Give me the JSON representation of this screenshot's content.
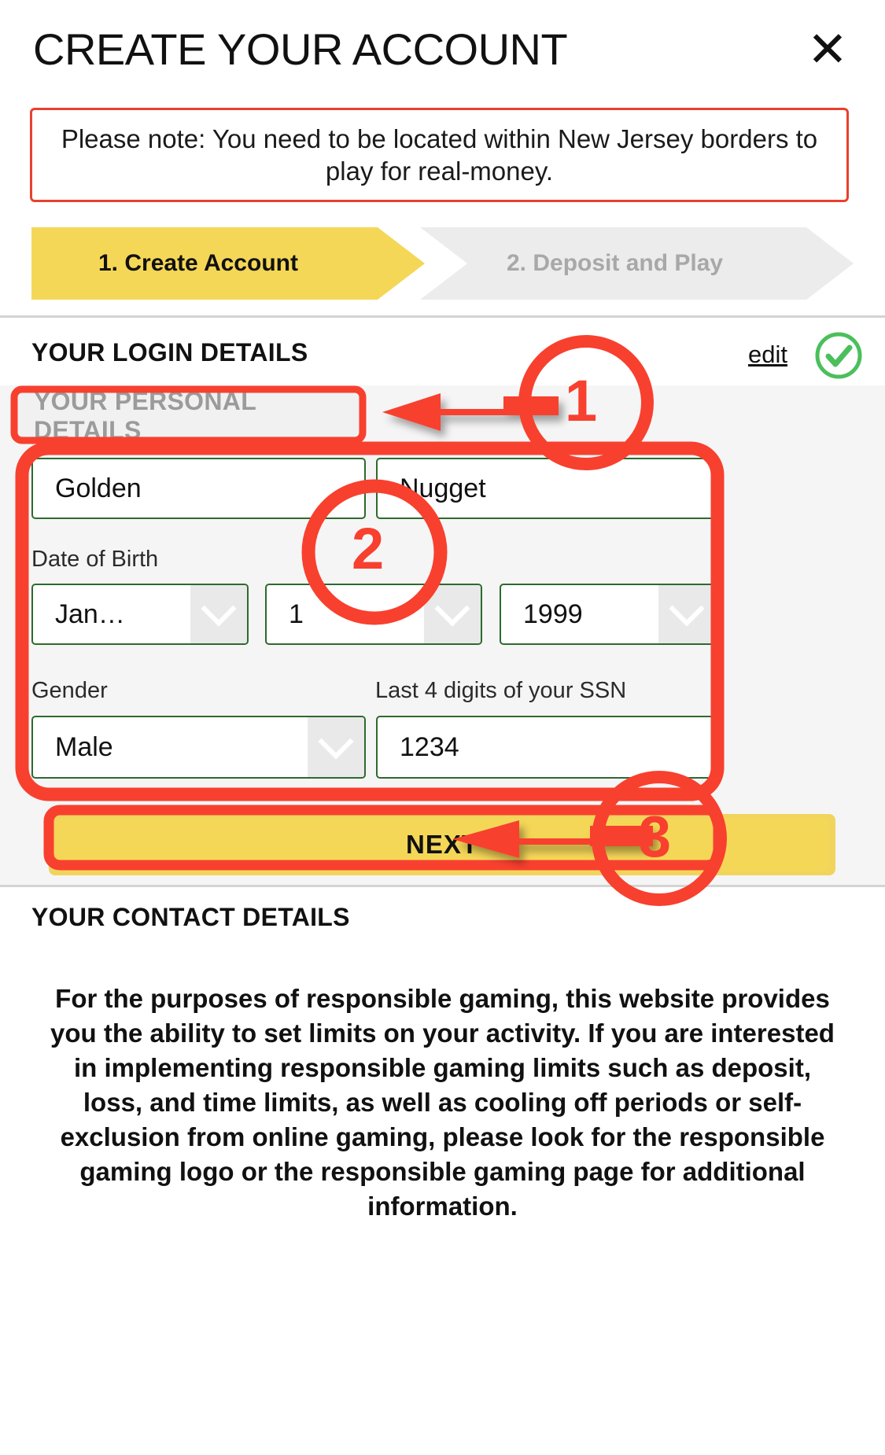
{
  "header": {
    "title": "CREATE YOUR ACCOUNT",
    "close_icon": "close-icon"
  },
  "notice": {
    "text": "Please note: You need to be located within New Jersey borders to play for real-money.",
    "border_color": "#e8412c"
  },
  "steps": [
    {
      "label": "1. Create Account",
      "state": "active",
      "color": "#f5d757"
    },
    {
      "label": "2. Deposit and Play",
      "state": "inactive",
      "color": "#ececec"
    }
  ],
  "login_details": {
    "heading": "YOUR LOGIN DETAILS",
    "edit_label": "edit",
    "status_icon": "check-circle-icon",
    "status_color": "#4bbf5c"
  },
  "personal_details": {
    "heading": "YOUR PERSONAL DETAILS",
    "first_name": {
      "value": "Golden"
    },
    "last_name": {
      "value": "Nugget"
    },
    "dob_label": "Date of Birth",
    "dob_month": {
      "value": "Jan…"
    },
    "dob_day": {
      "value": "1"
    },
    "dob_year": {
      "value": "1999"
    },
    "gender_label": "Gender",
    "gender": {
      "value": "Male"
    },
    "ssn_label": "Last 4 digits of your SSN",
    "ssn": {
      "value": "1234"
    },
    "next_label": "NEXT",
    "field_border_color": "#2d6a2d"
  },
  "contact_details": {
    "heading": "YOUR CONTACT DETAILS"
  },
  "responsible_gaming": {
    "text": "For the purposes of responsible gaming, this website provides you the ability to set limits on your activity. If you are interested in implementing responsible gaming limits such as deposit, loss, and time limits, as well as cooling off periods or self-exclusion from online gaming, please look for the responsible gaming logo or the responsible gaming page for additional information."
  },
  "annotations": {
    "color": "#f8402f",
    "markers": [
      {
        "number": "1",
        "target": "your-personal-details-header"
      },
      {
        "number": "2",
        "target": "personal-details-fields"
      },
      {
        "number": "3",
        "target": "next-button"
      }
    ]
  }
}
